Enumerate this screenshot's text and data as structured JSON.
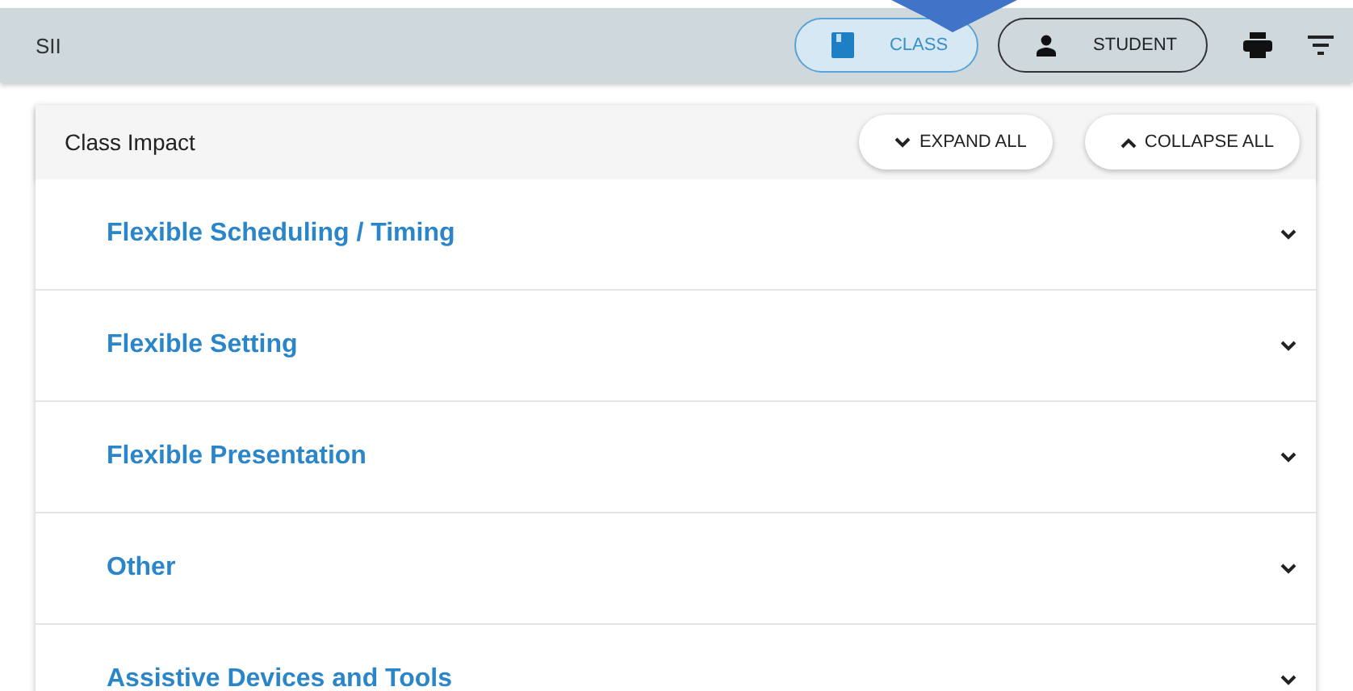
{
  "header": {
    "title": "SII",
    "views": [
      {
        "label": "CLASS",
        "selected": true,
        "kind": "book"
      },
      {
        "label": "STUDENT",
        "selected": false,
        "kind": "person"
      }
    ]
  },
  "card": {
    "title": "Class Impact",
    "actions": [
      {
        "label": "EXPAND ALL",
        "kind": "expand"
      },
      {
        "label": "COLLAPSE ALL",
        "kind": "collapse"
      }
    ],
    "sections": [
      {
        "title": "Flexible Scheduling / Timing",
        "expanded": false
      },
      {
        "title": "Flexible Setting",
        "expanded": false
      },
      {
        "title": "Flexible Presentation",
        "expanded": false
      },
      {
        "title": "Other",
        "expanded": false
      },
      {
        "title": "Assistive Devices and Tools",
        "expanded": false
      }
    ]
  }
}
